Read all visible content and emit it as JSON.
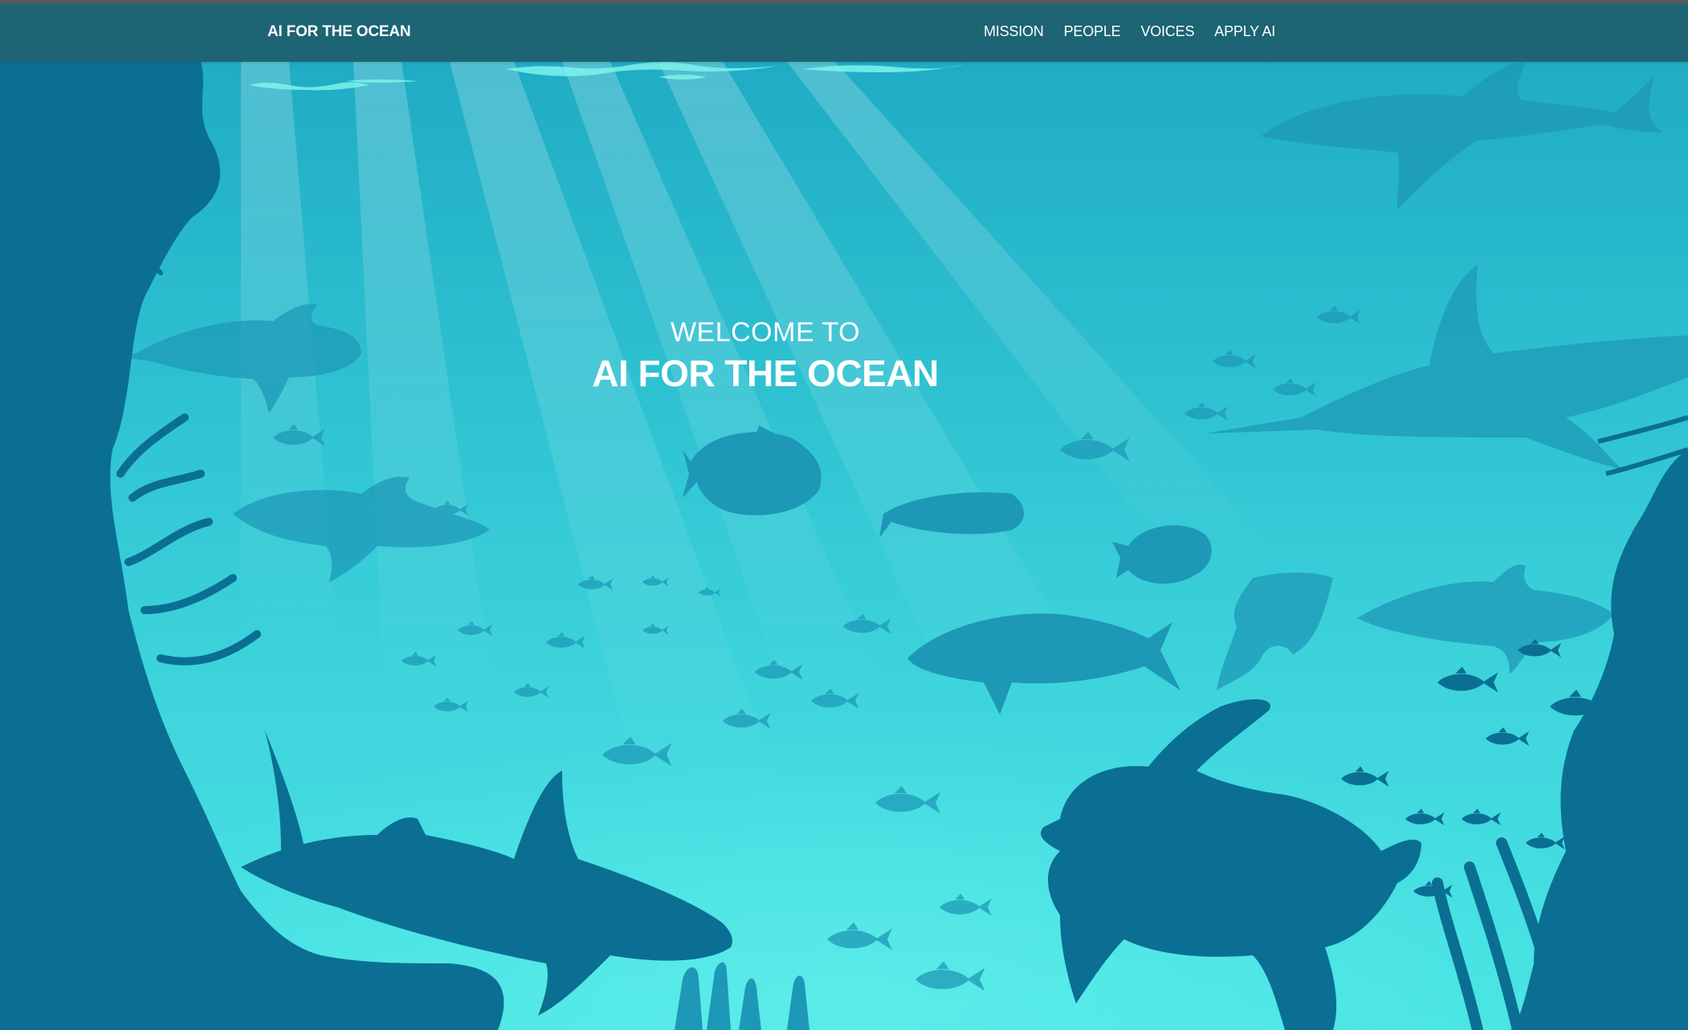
{
  "navbar": {
    "brand": "AI FOR THE OCEAN",
    "links": [
      {
        "label": "MISSION"
      },
      {
        "label": "PEOPLE"
      },
      {
        "label": "VOICES"
      },
      {
        "label": "APPLY AI"
      }
    ]
  },
  "hero": {
    "subtitle": "WELCOME TO",
    "title": "AI FOR THE OCEAN",
    "illustration": "underwater-scene-with-sharks-turtle-fish-coral"
  },
  "colors": {
    "navbar_bg": "#1e5a69",
    "water_top": "#1da8c2",
    "water_bottom": "#46e3e3",
    "silhouette_dark": "#0a6f93",
    "silhouette_mid": "#1e98b7",
    "text": "#ffffff"
  }
}
